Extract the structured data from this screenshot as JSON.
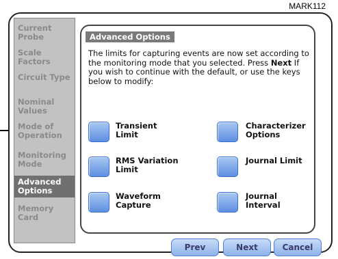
{
  "figure_label": "MARK112",
  "sidebar": {
    "items": [
      {
        "label": "Current Probe",
        "active": false
      },
      {
        "label": "Scale Factors",
        "active": false
      },
      {
        "label": "Circuit Type",
        "active": false
      },
      {
        "label": "Nominal Values",
        "active": false
      },
      {
        "label": "Mode of Operation",
        "active": false
      },
      {
        "label": "Monitoring Mode",
        "active": false
      },
      {
        "label": "Advanced Options",
        "active": true
      },
      {
        "label": "Memory Card",
        "active": false
      }
    ]
  },
  "panel": {
    "title": "Advanced Options",
    "desc_part1": "The limits for capturing events are now set according to the monitoring mode that you selected. Press ",
    "desc_bold": "Next",
    "desc_part2": " If you wish to continue with the default, or use the keys below to modify:",
    "options": [
      {
        "label": "Transient Limit"
      },
      {
        "label": "Characterizer Options"
      },
      {
        "label": "RMS Variation Limit"
      },
      {
        "label": "Journal Limit"
      },
      {
        "label": "Waveform Capture"
      },
      {
        "label": "Journal Interval"
      }
    ]
  },
  "buttons": {
    "prev": "Prev",
    "next": "Next",
    "cancel": "Cancel"
  },
  "colors": {
    "active_tab": "#707070",
    "button_blue": "#5d8fe0",
    "sidebar_bg": "#c2c2c2"
  }
}
